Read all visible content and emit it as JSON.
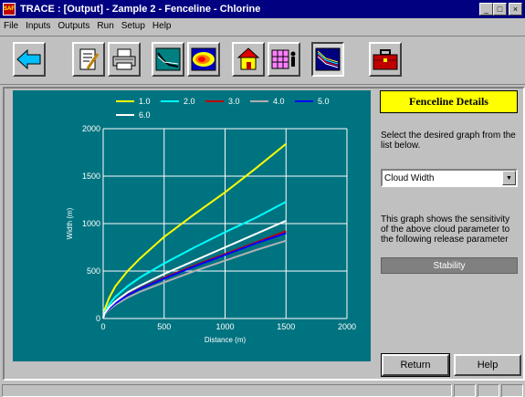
{
  "window": {
    "title": "TRACE : [Output] - Zample 2 - Fenceline - Chlorine",
    "app_icon_text": "SAF",
    "minimize": "_",
    "maximize": "□",
    "close": "×"
  },
  "menu": [
    "File",
    "Inputs",
    "Outputs",
    "Run",
    "Setup",
    "Help"
  ],
  "toolbar": {
    "buttons": [
      "back-arrow-icon",
      "report-icon",
      "printer-icon",
      "line-graph-icon",
      "contour-icon",
      "building-icon",
      "grid-person-icon",
      "fenceline-graph-icon",
      "briefcase-icon"
    ],
    "pressed": "fenceline-graph-icon"
  },
  "chart_data": {
    "type": "line",
    "xlabel": "Distance (m)",
    "ylabel": "Width (m)",
    "xlim": [
      0,
      2000
    ],
    "ylim": [
      0,
      2000
    ],
    "xticks": [
      0,
      500,
      1000,
      1500,
      2000
    ],
    "yticks": [
      0,
      500,
      1000,
      1500,
      2000
    ],
    "grid": true,
    "legend_position": "top",
    "x": [
      0,
      10,
      50,
      100,
      200,
      300,
      500,
      750,
      1000,
      1250,
      1500
    ],
    "series": [
      {
        "name": "1.0",
        "color": "#ffff00",
        "values": [
          0,
          90,
          220,
          340,
          500,
          630,
          860,
          1100,
          1330,
          1580,
          1840
        ]
      },
      {
        "name": "2.0",
        "color": "#00ffff",
        "values": [
          0,
          60,
          150,
          230,
          340,
          430,
          580,
          750,
          910,
          1060,
          1230
        ]
      },
      {
        "name": "3.0",
        "color": "#c00000",
        "values": [
          0,
          45,
          110,
          165,
          250,
          315,
          430,
          560,
          680,
          800,
          920
        ]
      },
      {
        "name": "4.0",
        "color": "#b0b0b0",
        "values": [
          0,
          40,
          95,
          145,
          220,
          280,
          380,
          500,
          610,
          720,
          820
        ]
      },
      {
        "name": "5.0",
        "color": "#0000ff",
        "values": [
          0,
          45,
          105,
          160,
          245,
          310,
          420,
          550,
          670,
          790,
          900
        ]
      },
      {
        "name": "6.0",
        "color": "#ffffff",
        "values": [
          0,
          50,
          120,
          180,
          275,
          345,
          470,
          610,
          750,
          890,
          1030
        ]
      }
    ]
  },
  "panel": {
    "heading": "Fenceline Details",
    "instructions": "Select the desired graph from the list below.",
    "graph_select_value": "Cloud Width",
    "description": "This graph shows the sensitivity of the above cloud parameter to the following release parameter",
    "parameter": "Stability",
    "return_label": "Return",
    "help_label": "Help"
  }
}
